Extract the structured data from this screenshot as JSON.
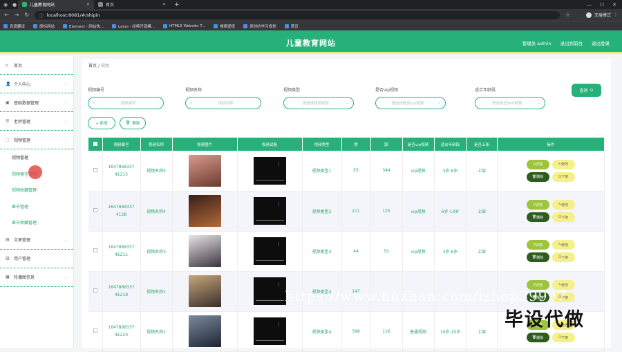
{
  "browser": {
    "tabs": [
      {
        "title": "儿童教育网站",
        "active": true
      },
      {
        "title": "首页",
        "active": false
      }
    ],
    "url": "localhost:8081/#/shipin",
    "account": "无痕模式",
    "bookmarks": [
      "百度翻译",
      "原标网站",
      "Element - 网站快...",
      "Layui - 经典开源模...",
      "HTML5 Website T...",
      "搜索壁纸",
      "原创的学习规划",
      "首页"
    ]
  },
  "site": {
    "title": "儿童教育网站",
    "nav": [
      "管理员 admin",
      "退出到前台",
      "退出登录"
    ]
  },
  "sidebar": {
    "home": "首页",
    "menus": [
      {
        "label": "个人中心"
      },
      {
        "label": "基础数据管理"
      },
      {
        "label": "老师管理"
      },
      {
        "label": "视频管理"
      }
    ],
    "submenus": [
      "视频管理",
      "视频留言管理",
      "视频收藏管理",
      "章节管理",
      "章节收藏管理"
    ],
    "menus2": [
      {
        "label": "文章管理"
      },
      {
        "label": "用户管理"
      },
      {
        "label": "轮播图信息"
      }
    ]
  },
  "breadcrumb": {
    "home": "首页",
    "sep": "/",
    "current": "视频"
  },
  "filters": [
    {
      "label": "视频编号",
      "placeholder": "视频编号"
    },
    {
      "label": "视频名称",
      "placeholder": "视频名称"
    },
    {
      "label": "视频类型",
      "placeholder": "请选择视频类型"
    },
    {
      "label": "是否vip视频",
      "placeholder": "请选择是否vip视频"
    },
    {
      "label": "适合年龄段",
      "placeholder": "请选择适合年龄段"
    }
  ],
  "actions": {
    "search": "查询",
    "add": "+ 新增",
    "delete": "删除"
  },
  "table": {
    "headers": [
      "视频编号",
      "视频名称",
      "视频图片",
      "视频试看",
      "视频类型",
      "赞",
      "踩",
      "是否vip视频",
      "适合年龄段",
      "是否上架",
      "操作"
    ],
    "rows": [
      {
        "id1": "1647868337",
        "id2": "41215",
        "name": "视频名称5",
        "type": "视频类型1",
        "up": "55",
        "down": "344",
        "vip": "vip视频",
        "age": "3岁-6岁",
        "status": "上架",
        "img": [
          "#d99a8e",
          "#6b3b2e"
        ]
      },
      {
        "id1": "1647868337",
        "id2": "4128",
        "name": "视频名称4",
        "type": "视频类型2",
        "up": "211",
        "down": "125",
        "vip": "vip视频",
        "age": "6岁-10岁",
        "status": "上架",
        "img": [
          "#3a1f18",
          "#b06a3c"
        ]
      },
      {
        "id1": "1647868337",
        "id2": "41211",
        "name": "视频名称3",
        "type": "视频类型4",
        "up": "44",
        "down": "52",
        "vip": "vip视频",
        "age": "3岁-6岁",
        "status": "上架",
        "img": [
          "#e9e4e4",
          "#3c3540"
        ]
      },
      {
        "id1": "1647868337",
        "id2": "41218",
        "name": "视频名称2",
        "type": "视频类型4",
        "up": "147",
        "down": "",
        "vip": "",
        "age": "",
        "status": "",
        "img": [
          "#c7a77c",
          "#3a2e2a"
        ]
      },
      {
        "id1": "1647868337",
        "id2": "41220",
        "name": "视频名称1",
        "type": "视频类型4",
        "up": "398",
        "down": "116",
        "vip": "普通视频",
        "age": "10岁-15岁",
        "status": "上架",
        "img": [
          "#7c8a9e",
          "#1d2430"
        ]
      }
    ],
    "ops": {
      "detail": "详情",
      "edit": "修改",
      "del": "删除",
      "down": "下架"
    }
  },
  "watermark": {
    "url": "https://www.huzhan.com/ishop39997",
    "text": "毕设代做"
  }
}
